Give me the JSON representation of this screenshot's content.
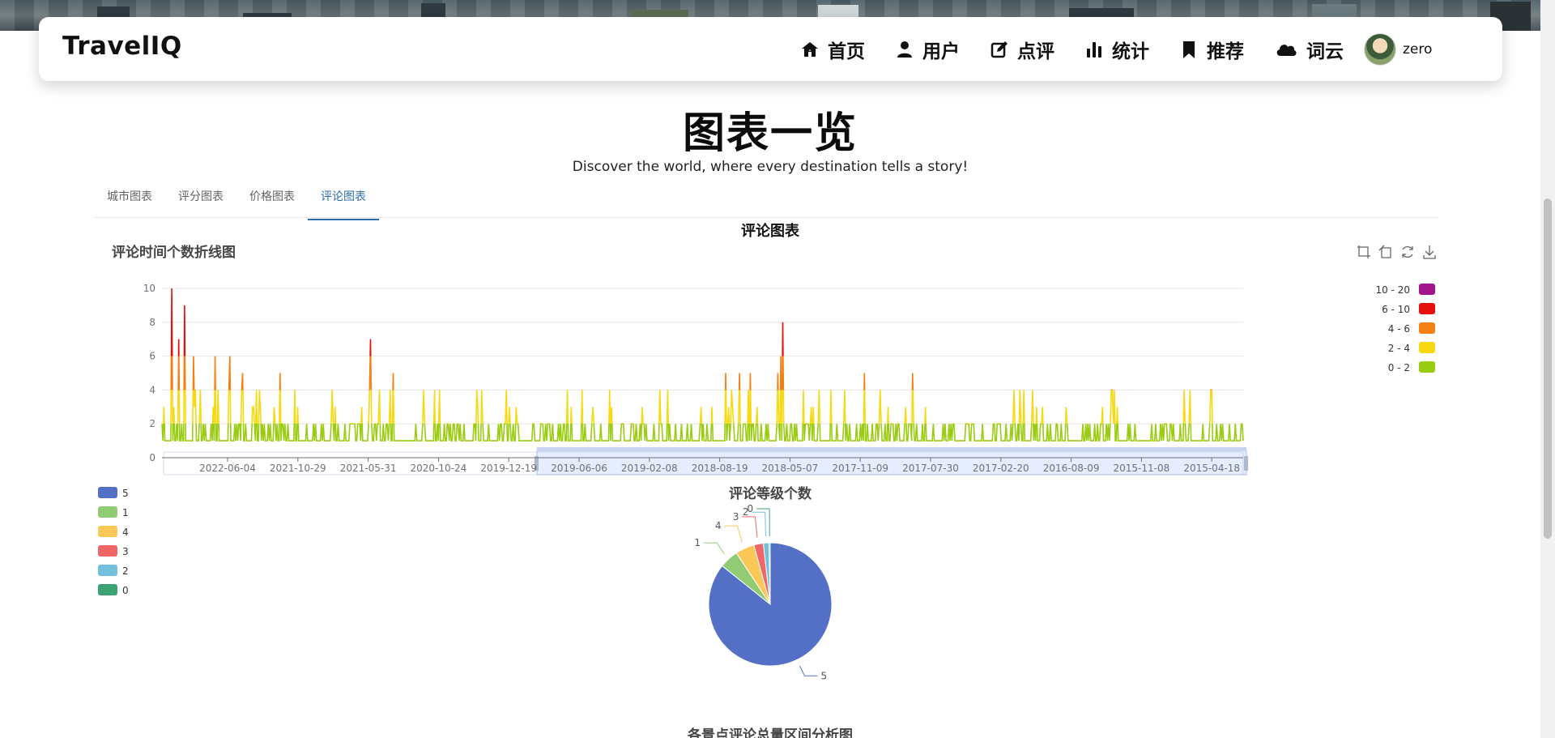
{
  "header": {
    "brand": "TravelIQ",
    "nav": [
      {
        "label": "首页",
        "icon": "home-icon"
      },
      {
        "label": "用户",
        "icon": "user-icon"
      },
      {
        "label": "点评",
        "icon": "edit-icon"
      },
      {
        "label": "统计",
        "icon": "bar-chart-icon"
      },
      {
        "label": "推荐",
        "icon": "bookmark-icon"
      },
      {
        "label": "词云",
        "icon": "cloud-icon"
      }
    ],
    "username": "zero"
  },
  "page": {
    "title": "图表一览",
    "subtitle": "Discover the world, where every destination tells a story!"
  },
  "tabs": {
    "items": [
      "城市图表",
      "评分图表",
      "价格图表",
      "评论图表"
    ],
    "active_index": 3
  },
  "section_title": "评论图表",
  "chart_data": [
    {
      "type": "line",
      "title": "评论时间个数折线图",
      "ylim": [
        0,
        10
      ],
      "yticks": [
        "0",
        "2",
        "4",
        "6",
        "8",
        "10"
      ],
      "x_tick_labels": [
        "2022-06-04",
        "2021-10-29",
        "2021-05-31",
        "2020-10-24",
        "2019-12-19",
        "2019-06-06",
        "2019-02-08",
        "2018-08-19",
        "2018-05-07",
        "2017-11-09",
        "2017-07-30",
        "2017-02-20",
        "2016-08-09",
        "2015-11-08",
        "2015-04-18"
      ],
      "peaks": [
        {
          "x": "2022-06-04",
          "y": 10
        },
        {
          "x": "2022-06-04",
          "y": 9
        },
        {
          "x": "2018-05-07",
          "y": 8
        },
        {
          "x": "2021-05-31",
          "y": 7
        }
      ],
      "visual_map": [
        {
          "label": "10 - 20",
          "color": "#a2158c"
        },
        {
          "label": "6 - 10",
          "color": "#e70e0e"
        },
        {
          "label": "4 - 6",
          "color": "#f57f12"
        },
        {
          "label": "2 - 4",
          "color": "#f7d911"
        },
        {
          "label": "0 - 2",
          "color": "#9acc11"
        }
      ],
      "grid": true,
      "toolbox": [
        "zoom-icon",
        "zoom-reset-icon",
        "restore-icon",
        "download-icon"
      ]
    },
    {
      "type": "pie",
      "title": "评论等级个数",
      "slices": [
        {
          "name": "5",
          "value": 86,
          "color": "#5470c6"
        },
        {
          "name": "1",
          "value": 5,
          "color": "#91cc75"
        },
        {
          "name": "4",
          "value": 5,
          "color": "#fac858"
        },
        {
          "name": "3",
          "value": 2.5,
          "color": "#ee6666"
        },
        {
          "name": "2",
          "value": 1.5,
          "color": "#73c0de"
        },
        {
          "name": "0",
          "value": 0.3,
          "color": "#3ba272"
        }
      ],
      "legend_placement": "left"
    },
    {
      "type": "bar",
      "title": "各景点评论总量区间分析图"
    }
  ]
}
